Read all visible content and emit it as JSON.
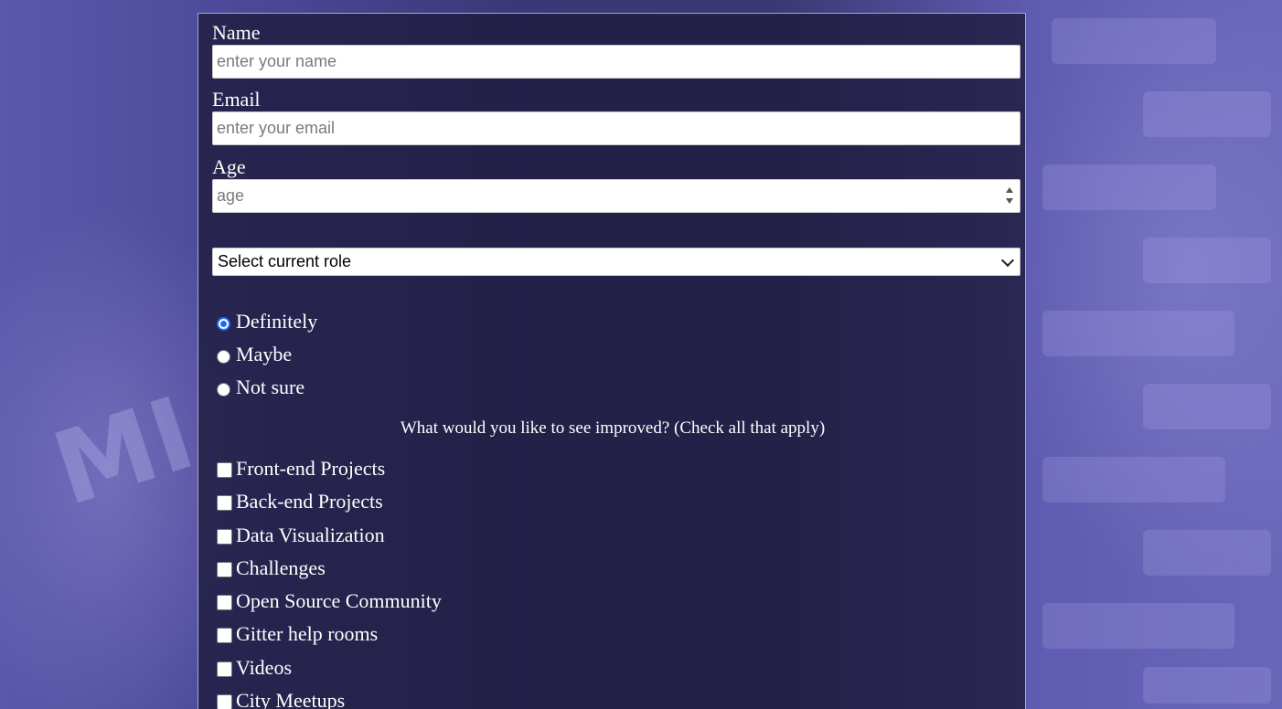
{
  "form": {
    "name": {
      "label": "Name",
      "placeholder": "enter your name"
    },
    "email": {
      "label": "Email",
      "placeholder": "enter your email"
    },
    "age": {
      "label": "Age",
      "placeholder": "age"
    },
    "role": {
      "selected": "Select current role"
    },
    "radios": [
      {
        "label": "Definitely",
        "checked": true
      },
      {
        "label": "Maybe",
        "checked": false
      },
      {
        "label": "Not sure",
        "checked": false
      }
    ],
    "improve_question": "What would you like to see improved? (Check all that apply)",
    "checkboxes": [
      {
        "label": "Front-end Projects",
        "checked": false
      },
      {
        "label": "Back-end Projects",
        "checked": false
      },
      {
        "label": "Data Visualization",
        "checked": false
      },
      {
        "label": "Challenges",
        "checked": false
      },
      {
        "label": "Open Source Community",
        "checked": false
      },
      {
        "label": "Gitter help rooms",
        "checked": false
      },
      {
        "label": "Videos",
        "checked": false
      },
      {
        "label": "City Meetups",
        "checked": false
      }
    ]
  },
  "colors": {
    "panel": "#1e1c3e",
    "accent_radio": "#1a6cf0",
    "background": "#5a56a8"
  }
}
